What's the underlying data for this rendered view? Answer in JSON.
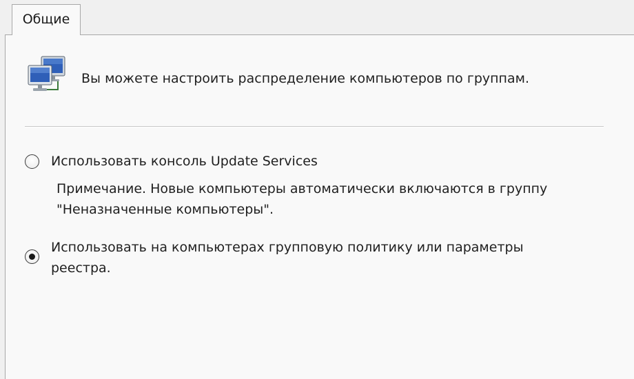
{
  "tabs": [
    {
      "label": "Общие",
      "active": true
    }
  ],
  "header": {
    "icon": "network-computers-icon",
    "text": "Вы можете настроить распределение компьютеров по группам."
  },
  "options": [
    {
      "label": "Использовать консоль Update Services",
      "selected": false,
      "note_line1": "Примечание. Новые компьютеры автоматически включаются в группу",
      "note_line2": "\"Неназначенные компьютеры\"."
    },
    {
      "label_line1": "Использовать на компьютерах групповую политику или параметры",
      "label_line2": "реестра.",
      "selected": true
    }
  ],
  "colors": {
    "background": "#f0f0f0",
    "panel": "#f9f9f9",
    "border": "#a8a8a8",
    "monitor_screen": "#2f5fb8"
  }
}
